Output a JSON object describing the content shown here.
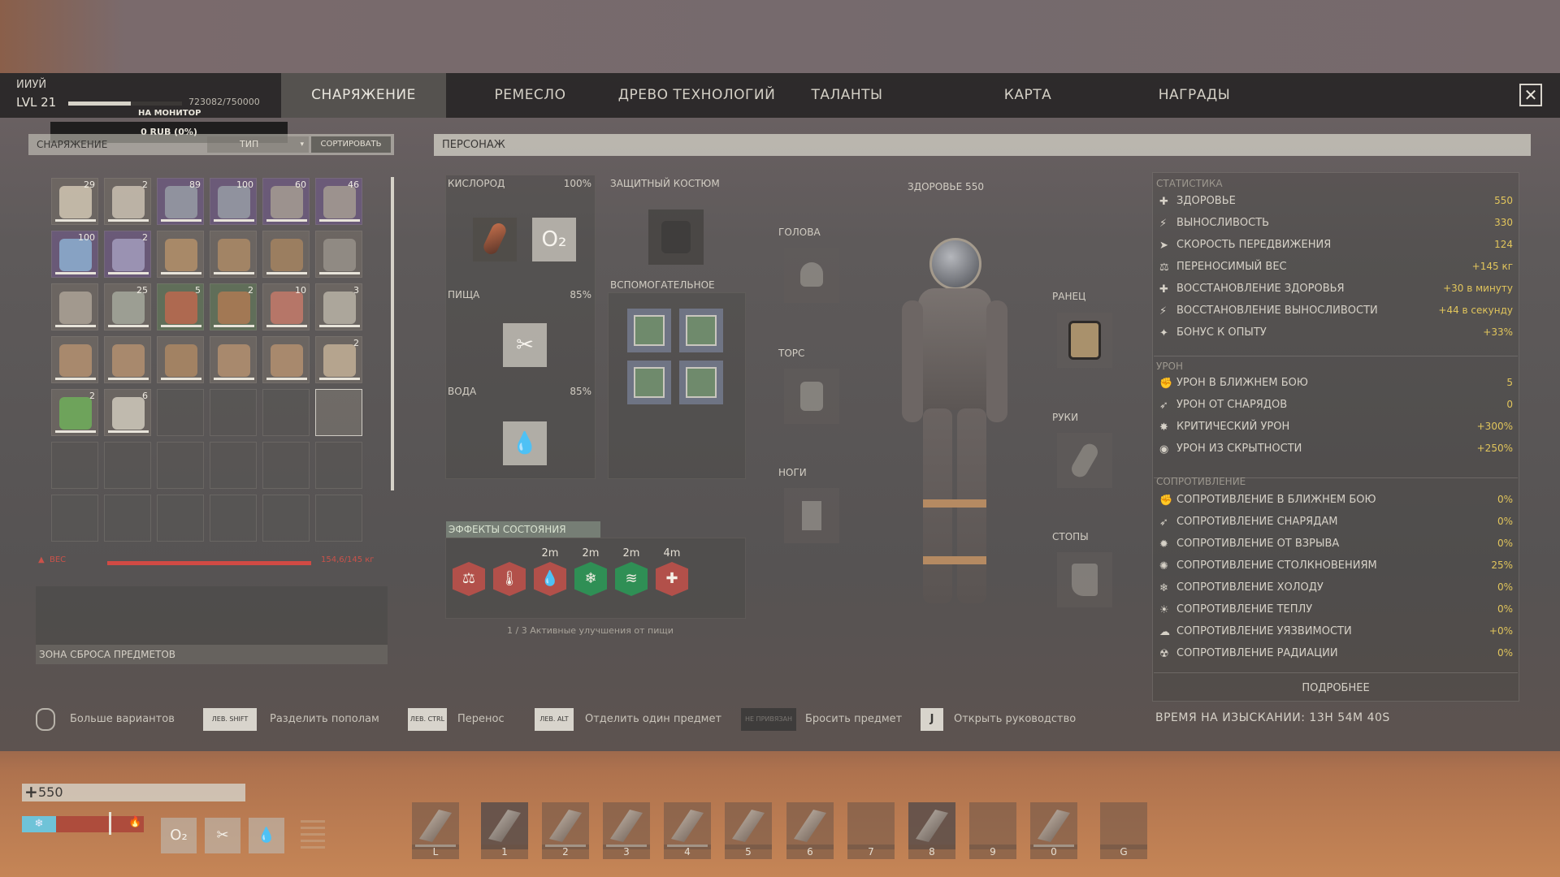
{
  "player": {
    "name": "ИИУЙ",
    "level": "LVL 21",
    "xp_text": "723082/750000",
    "xp_fraction": 0.55,
    "monitor": "НА МОНИТОР",
    "currency": "0 RUB (0%)"
  },
  "tabs": [
    {
      "label": "СНАРЯЖЕНИЕ",
      "active": true
    },
    {
      "label": "РЕМЕСЛО"
    },
    {
      "label": "ДРЕВО ТЕХНОЛОГИЙ"
    },
    {
      "label": "ТАЛАНТЫ"
    },
    {
      "label": "КАРТА"
    },
    {
      "label": "НАГРАДЫ"
    }
  ],
  "close_label": "✕",
  "inventory": {
    "title": "СНАРЯЖЕНИЕ",
    "type_label": "ТИП",
    "sort_label": "СОРТИРОВАТЬ",
    "items": [
      {
        "count": "29",
        "icon": "bone-club-icon",
        "tone": "filled"
      },
      {
        "count": "2",
        "icon": "stone-spear-icon",
        "tone": "filled"
      },
      {
        "count": "89",
        "icon": "sword-icon",
        "tone": "purple"
      },
      {
        "count": "100",
        "icon": "sword-icon",
        "tone": "purple"
      },
      {
        "count": "60",
        "icon": "spear-icon",
        "tone": "purple"
      },
      {
        "count": "46",
        "icon": "spear-icon",
        "tone": "purple"
      },
      {
        "count": "100",
        "icon": "hammer-icon",
        "tone": "purple"
      },
      {
        "count": "2",
        "icon": "pickaxe-icon",
        "tone": "purple"
      },
      {
        "count": "",
        "icon": "chair-icon",
        "tone": "filled"
      },
      {
        "count": "",
        "icon": "workbench-icon",
        "tone": "filled"
      },
      {
        "count": "",
        "icon": "crafting-bench-icon",
        "tone": "filled"
      },
      {
        "count": "",
        "icon": "campfire-icon",
        "tone": "filled"
      },
      {
        "count": "",
        "icon": "furnace-icon",
        "tone": "filled"
      },
      {
        "count": "25",
        "icon": "stone-icon",
        "tone": "filled"
      },
      {
        "count": "5",
        "icon": "raw-meat-icon",
        "tone": "green"
      },
      {
        "count": "2",
        "icon": "cooked-meat-icon",
        "tone": "green"
      },
      {
        "count": "10",
        "icon": "ore-icon",
        "tone": "filled"
      },
      {
        "count": "3",
        "icon": "arrow-icon",
        "tone": "filled"
      },
      {
        "count": "",
        "icon": "crate-icon",
        "tone": "filled"
      },
      {
        "count": "",
        "icon": "crate-icon",
        "tone": "filled"
      },
      {
        "count": "",
        "icon": "cabinet-icon",
        "tone": "filled"
      },
      {
        "count": "",
        "icon": "crate-icon",
        "tone": "filled"
      },
      {
        "count": "",
        "icon": "crate-icon",
        "tone": "filled"
      },
      {
        "count": "2",
        "icon": "wall-icon",
        "tone": "filled"
      },
      {
        "count": "2",
        "icon": "plant-fiber-icon",
        "tone": "filled"
      },
      {
        "count": "6",
        "icon": "bandage-icon",
        "tone": "filled"
      }
    ],
    "weight_label": "ВЕС",
    "weight_value": "154,6/145 кг",
    "weight_fraction": 1.0,
    "dropzone_label": "ЗОНА СБРОСА ПРЕДМЕТОВ"
  },
  "character": {
    "title": "ПЕРСОНАЖ",
    "oxygen": {
      "label": "КИСЛОРОД",
      "value": "100%",
      "o2": "O₂"
    },
    "food": {
      "label": "ПИЩА",
      "value": "85%"
    },
    "water": {
      "label": "ВОДА",
      "value": "85%"
    },
    "suit_label": "ЗАЩИТНЫЙ КОСТЮМ",
    "auxiliary_label": "ВСПОМОГАТЕЛЬНОЕ",
    "health_label": "ЗДОРОВЬЕ 550",
    "slots": {
      "head": "ГОЛОВА",
      "torso": "ТОРС",
      "legs": "НОГИ",
      "backpack": "РАНЕЦ",
      "hands": "РУКИ",
      "feet": "СТОПЫ"
    },
    "effects_label": "ЭФФЕКТЫ СОСТОЯНИЯ",
    "effects": [
      {
        "time": "",
        "icon": "weight-warning-icon",
        "color": "#b2504a"
      },
      {
        "time": "",
        "icon": "temperature-icon",
        "color": "#b2504a"
      },
      {
        "time": "2m",
        "icon": "water-drop-icon",
        "color": "#b2504a"
      },
      {
        "time": "2m",
        "icon": "snowflake-icon",
        "color": "#2f8f55"
      },
      {
        "time": "2m",
        "icon": "comb-food-icon",
        "color": "#2f8f55"
      },
      {
        "time": "4m",
        "icon": "bandage-icon",
        "color": "#b2504a"
      }
    ],
    "food_bonus": "1 / 3 Активные улучшения от пищи"
  },
  "stats": {
    "stats_label": "СТАТИСТИКА",
    "rows": [
      {
        "name": "ЗДОРОВЬЕ",
        "value": "550",
        "icon": "plus-icon"
      },
      {
        "name": "ВЫНОСЛИВОСТЬ",
        "value": "330",
        "icon": "bolt-icon"
      },
      {
        "name": "СКОРОСТЬ ПЕРЕДВИЖЕНИЯ",
        "value": "124",
        "icon": "speed-icon"
      },
      {
        "name": "ПЕРЕНОСИМЫЙ ВЕС",
        "value": "+145 кг",
        "icon": "weight-icon"
      },
      {
        "name": "ВОССТАНОВЛЕНИЕ ЗДОРОВЬЯ",
        "value": "+30 в минуту",
        "icon": "health-regen-icon"
      },
      {
        "name": "ВОССТАНОВЛЕНИЕ ВЫНОСЛИВОСТИ",
        "value": "+44 в секунду",
        "icon": "stamina-regen-icon"
      },
      {
        "name": "БОНУС К ОПЫТУ",
        "value": "+33%",
        "icon": "xp-icon"
      }
    ],
    "damage_label": "УРОН",
    "damage": [
      {
        "name": "УРОН В БЛИЖНЕМ БОЮ",
        "value": "5",
        "icon": "fist-icon"
      },
      {
        "name": "УРОН ОТ СНАРЯДОВ",
        "value": "0",
        "icon": "projectile-icon"
      },
      {
        "name": "КРИТИЧЕСКИЙ УРОН",
        "value": "+300%",
        "icon": "crit-icon"
      },
      {
        "name": "УРОН ИЗ СКРЫТНОСТИ",
        "value": "+250%",
        "icon": "eye-icon"
      }
    ],
    "resist_label": "СОПРОТИВЛЕНИЕ",
    "resist": [
      {
        "name": "СОПРОТИВЛЕНИЕ В БЛИЖНЕМ БОЮ",
        "value": "0%",
        "icon": "melee-resist-icon"
      },
      {
        "name": "СОПРОТИВЛЕНИЕ СНАРЯДАМ",
        "value": "0%",
        "icon": "projectile-resist-icon"
      },
      {
        "name": "СОПРОТИВЛЕНИЕ ОТ ВЗРЫВА",
        "value": "0%",
        "icon": "explosion-icon"
      },
      {
        "name": "СОПРОТИВЛЕНИЕ СТОЛКНОВЕНИЯМ",
        "value": "25%",
        "icon": "impact-icon"
      },
      {
        "name": "СОПРОТИВЛЕНИЕ ХОЛОДУ",
        "value": "0%",
        "icon": "snowflake-icon"
      },
      {
        "name": "СОПРОТИВЛЕНИЕ ТЕПЛУ",
        "value": "0%",
        "icon": "sun-icon"
      },
      {
        "name": "СОПРОТИВЛЕНИЕ УЯЗВИМОСТИ",
        "value": "+0%",
        "icon": "cloud-icon"
      },
      {
        "name": "СОПРОТИВЛЕНИЕ РАДИАЦИИ",
        "value": "0%",
        "icon": "radiation-icon"
      }
    ],
    "more_label": "ПОДРОБНЕЕ",
    "survey_time": "ВРЕМЯ НА ИЗЫСКАНИИ: 13Н 54М 40S"
  },
  "hints": [
    {
      "key": "",
      "hint": "Больше вариантов"
    },
    {
      "key": "ЛЕВ. SHIFT",
      "hint": "Разделить пополам"
    },
    {
      "key": "ЛЕВ. CTRL",
      "hint": "Перенос"
    },
    {
      "key": "ЛЕВ. ALT",
      "hint": "Отделить один предмет"
    },
    {
      "key": "НЕ ПРИВЯЗАН",
      "hint": "Бросить предмет"
    },
    {
      "key": "J",
      "hint": "Открыть руководство"
    }
  ],
  "hud": {
    "health": "550",
    "health_fraction": 1.0,
    "temperature_fraction": 0.7,
    "vitals": [
      "O₂",
      "✂",
      "💧"
    ],
    "hotbar": [
      {
        "key": "L",
        "icon": "torch-icon",
        "bar": true,
        "sel": false
      },
      {
        "key": "1",
        "icon": "bow-icon",
        "bar": false,
        "sel": true
      },
      {
        "key": "2",
        "icon": "hammer-icon",
        "bar": true,
        "sel": false
      },
      {
        "key": "3",
        "icon": "pickaxe-icon",
        "bar": true,
        "sel": false
      },
      {
        "key": "4",
        "icon": "axe-icon",
        "bar": true,
        "sel": false
      },
      {
        "key": "5",
        "icon": "bow-icon",
        "bar": false,
        "sel": false
      },
      {
        "key": "6",
        "icon": "canteen-icon",
        "bar": false,
        "sel": false
      },
      {
        "key": "7",
        "icon": "",
        "bar": false,
        "sel": false
      },
      {
        "key": "8",
        "icon": "sickle-icon",
        "bar": false,
        "sel": true
      },
      {
        "key": "9",
        "icon": "",
        "bar": false,
        "sel": false
      },
      {
        "key": "0",
        "icon": "pickaxe-icon",
        "bar": true,
        "sel": false
      },
      {
        "key": "G",
        "icon": "",
        "bar": false,
        "sel": false
      }
    ]
  },
  "colors": {
    "accent_yellow": "#e1c55c",
    "danger_red": "#d14a44",
    "buff_green": "#2f8f55",
    "debuff_red": "#b2504a"
  }
}
